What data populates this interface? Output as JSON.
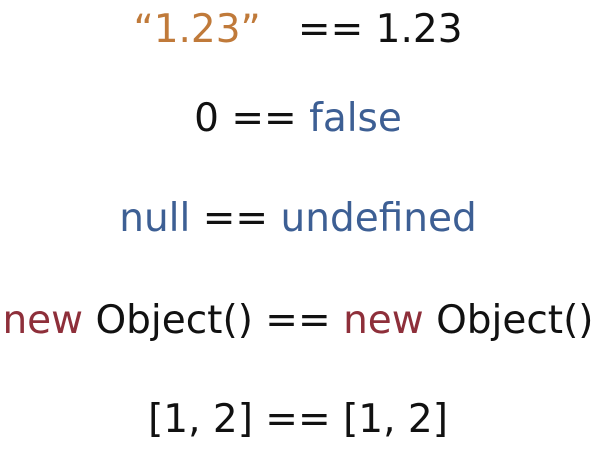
{
  "colors": {
    "default": "#111111",
    "string": "#c07a3a",
    "keyword": "#3d5f94",
    "new_keyword": "#8e2f3a"
  },
  "lines": [
    {
      "segments": [
        {
          "text": "“1.23”",
          "style": "string"
        },
        {
          "text": "   == 1.23",
          "style": "default"
        }
      ]
    },
    {
      "segments": [
        {
          "text": "0 == ",
          "style": "default"
        },
        {
          "text": "false",
          "style": "keyword"
        }
      ]
    },
    {
      "segments": [
        {
          "text": "null",
          "style": "keyword"
        },
        {
          "text": " == ",
          "style": "default"
        },
        {
          "text": "undefined",
          "style": "keyword"
        }
      ]
    },
    {
      "segments": [
        {
          "text": "new",
          "style": "new_keyword"
        },
        {
          "text": " Object() == ",
          "style": "default"
        },
        {
          "text": "new",
          "style": "new_keyword"
        },
        {
          "text": " Object()",
          "style": "default"
        }
      ]
    },
    {
      "segments": [
        {
          "text": "[1, 2] == [1, 2]",
          "style": "default"
        }
      ]
    }
  ]
}
